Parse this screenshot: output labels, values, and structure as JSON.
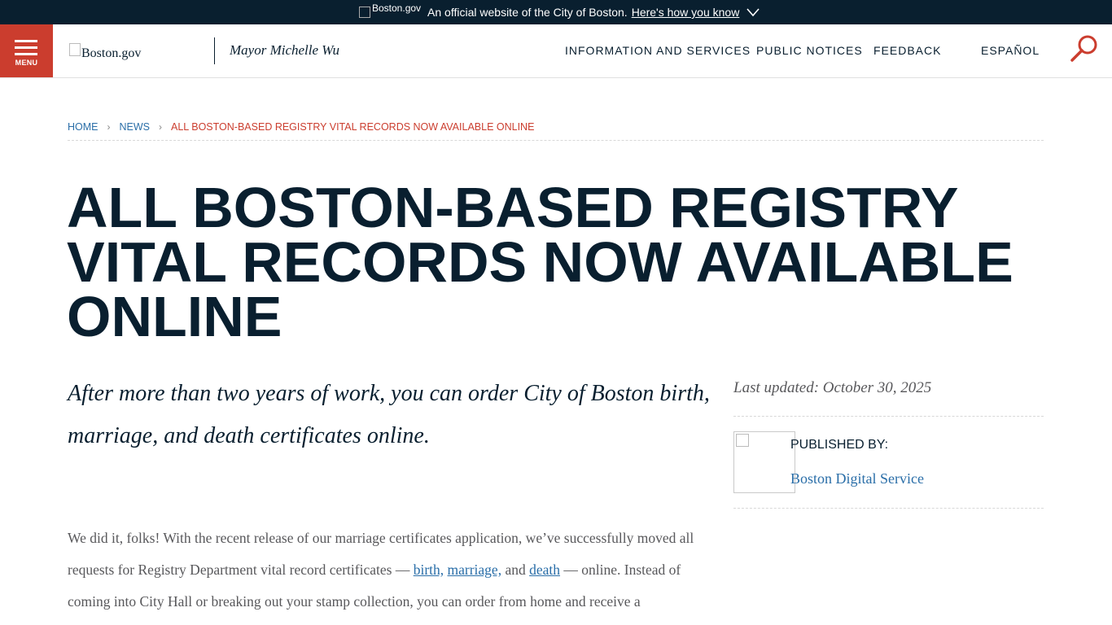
{
  "banner": {
    "logo_alt": "Boston.gov",
    "text": "An official website of the City of Boston.",
    "link": "Here's how you know"
  },
  "header": {
    "menu_label": "MENU",
    "logo_alt": "Boston.gov",
    "mayor": "Mayor Michelle Wu",
    "nav": {
      "info": "INFORMATION AND SERVICES",
      "notices": "PUBLIC NOTICES",
      "feedback": "FEEDBACK",
      "espanol": "ESPAÑOL"
    }
  },
  "breadcrumb": {
    "home": "HOME",
    "news": "NEWS",
    "sep": "›",
    "current": "ALL BOSTON-BASED REGISTRY VITAL RECORDS NOW AVAILABLE ONLINE"
  },
  "article": {
    "title": "ALL BOSTON-BASED REGISTRY VITAL RECORDS NOW AVAILABLE ONLINE",
    "intro": "After more than two years of work, you can order City of Boston birth, marriage, and death certificates online.",
    "body": {
      "p1_start": "We did it, folks! With the recent release of our marriage certificates application, we’ve successfully moved all requests for Registry Department vital record certificates — ",
      "link_birth": "birth,",
      "link_marriage": "marriage,",
      "and": " and ",
      "link_death": "death",
      "p1_end": " — online. Instead of coming into City Hall or breaking out your stamp collection, you can order from home and receive a"
    }
  },
  "sidebar": {
    "updated": "Last updated: October 30, 2025",
    "published_by_label": "PUBLISHED BY:",
    "publisher": "Boston Digital Service"
  },
  "colors": {
    "navy": "#091f2f",
    "red": "#cb3d2e",
    "link": "#2a6ea8"
  }
}
